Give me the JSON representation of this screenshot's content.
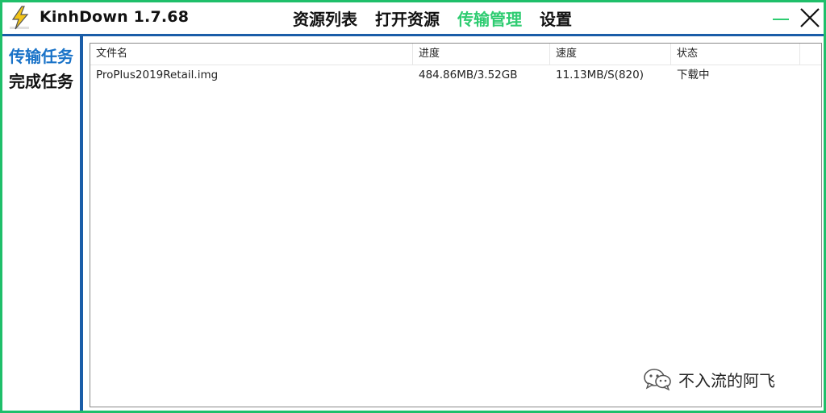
{
  "app": {
    "title": "KinhDown 1.7.68"
  },
  "nav": {
    "items": [
      {
        "label": "资源列表",
        "active": false
      },
      {
        "label": "打开资源",
        "active": false
      },
      {
        "label": "传输管理",
        "active": true
      },
      {
        "label": "设置",
        "active": false
      }
    ]
  },
  "sidebar": {
    "items": [
      {
        "label": "传输任务",
        "active": true
      },
      {
        "label": "完成任务",
        "active": false
      }
    ]
  },
  "table": {
    "columns": [
      "文件名",
      "进度",
      "速度",
      "状态"
    ],
    "rows": [
      {
        "filename": "ProPlus2019Retail.img",
        "progress": "484.86MB/3.52GB",
        "speed": "11.13MB/S(820)",
        "status": "下载中"
      }
    ]
  },
  "watermark": {
    "text": "不入流的阿飞"
  },
  "colors": {
    "accent_green": "#2ecc71",
    "border_green": "#1fbf6a",
    "sidebar_active_blue": "#1a73c8",
    "separator_blue": "#1a5da8"
  },
  "icons": {
    "logo": "lightning-bolt-icon",
    "minimize": "minimize-icon",
    "close": "close-icon",
    "watermark": "wechat-icon"
  }
}
